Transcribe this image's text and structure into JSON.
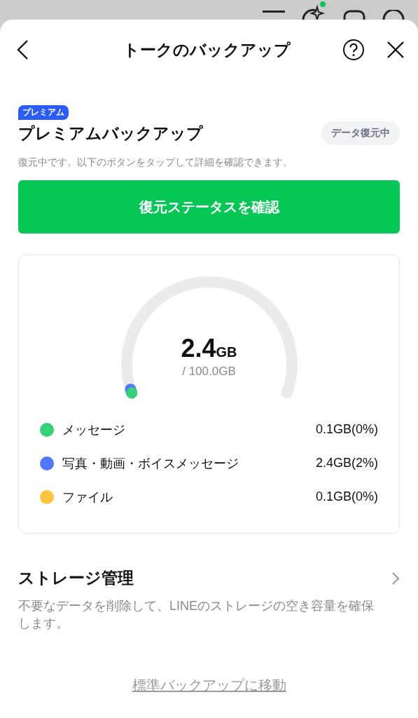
{
  "header": {
    "title": "トークのバックアップ"
  },
  "premium": {
    "badge": "プレミアム",
    "title": "プレミアムバックアップ",
    "status": "データ復元中",
    "description": "復元中です。以下のボタンをタップして詳細を確認できます。",
    "button": "復元ステータスを確認"
  },
  "usage": {
    "used": "2.4",
    "used_unit": "GB",
    "total": "/ 100.0GB",
    "categories": [
      {
        "label": "メッセージ",
        "value": "0.1GB(0%)",
        "color": "#36d27a"
      },
      {
        "label": "写真・動画・ボイスメッセージ",
        "value": "2.4GB(2%)",
        "color": "#5277fa"
      },
      {
        "label": "ファイル",
        "value": "0.1GB(0%)",
        "color": "#fec53f"
      }
    ]
  },
  "storage": {
    "title": "ストレージ管理",
    "description": "不要なデータを削除して、LINEのストレージの空き容量を確保します。"
  },
  "footer_link": "標準バックアップに移動"
}
